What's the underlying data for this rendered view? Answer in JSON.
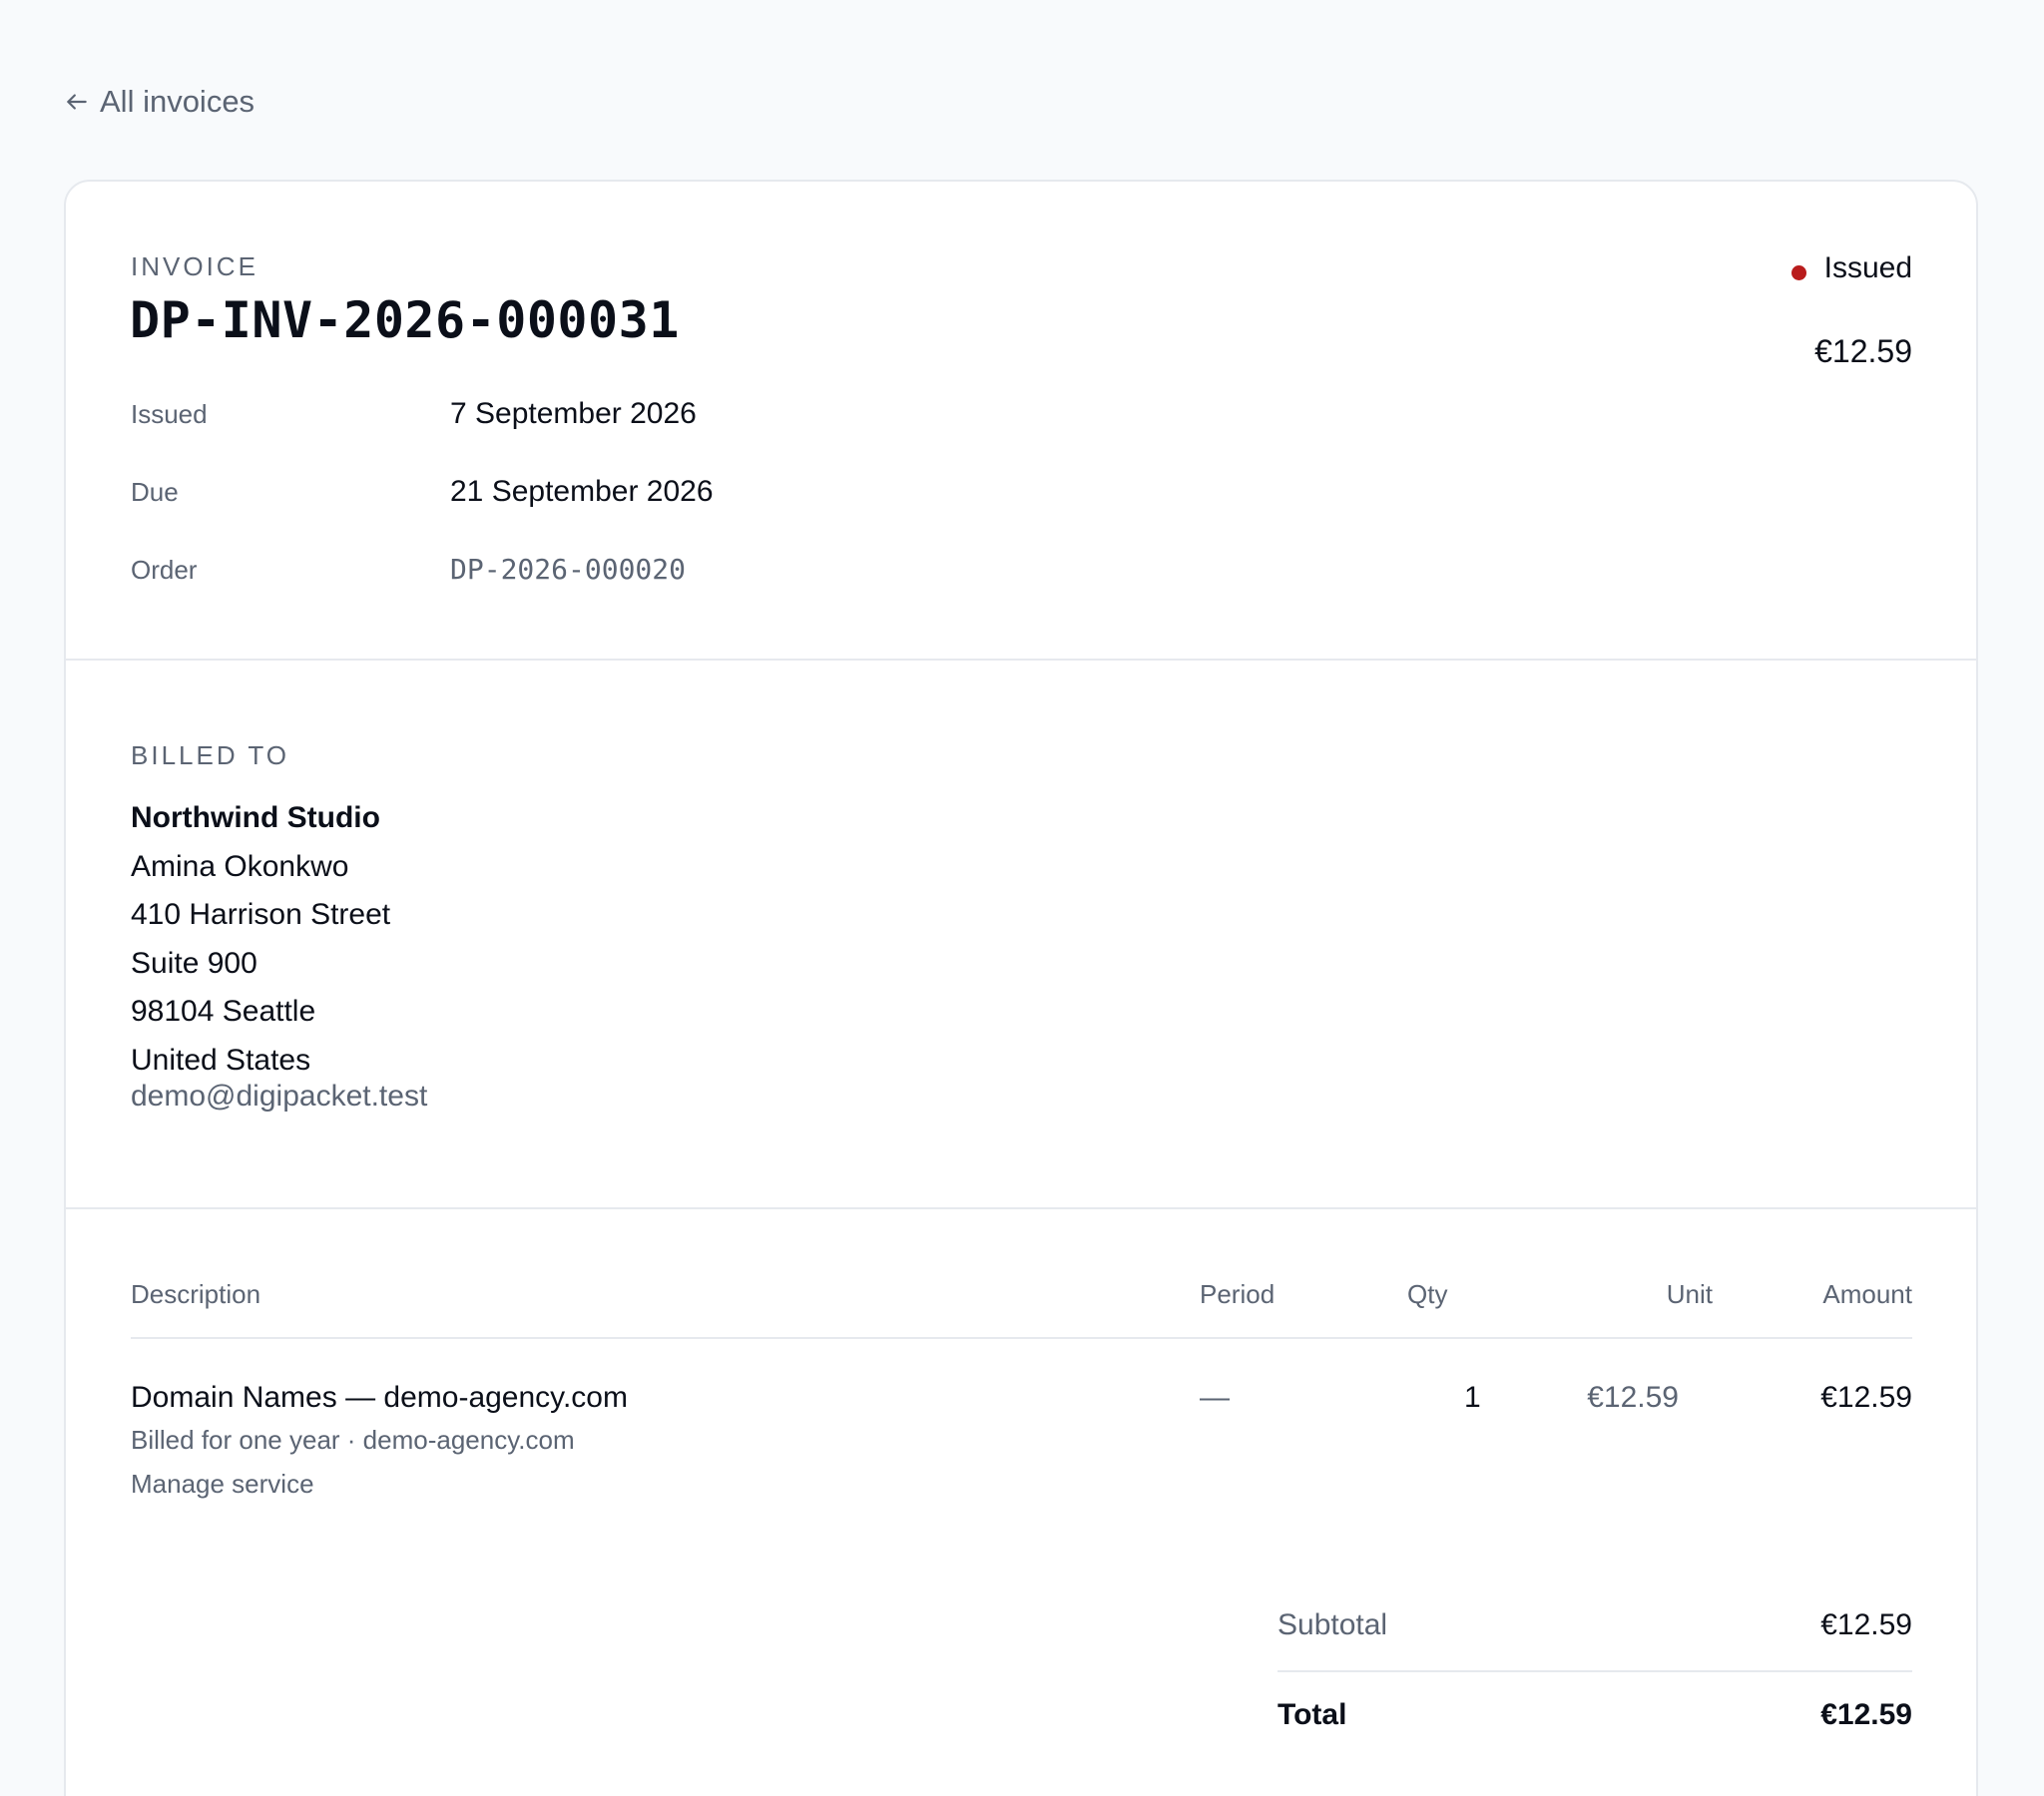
{
  "nav": {
    "back_label": "All invoices"
  },
  "invoice": {
    "eyebrow": "INVOICE",
    "number": "DP-INV-2026-000031",
    "status": "Issued",
    "amount": "€12.59",
    "meta": {
      "issued_label": "Issued",
      "issued_value": "7 September 2026",
      "due_label": "Due",
      "due_value": "21 September 2026",
      "order_label": "Order",
      "order_value": "DP-2026-000020"
    }
  },
  "billed_to": {
    "eyebrow": "BILLED TO",
    "company": "Northwind Studio",
    "name": "Amina Okonkwo",
    "address_line1": "410 Harrison Street",
    "address_line2": "Suite 900",
    "city_line": "98104 Seattle",
    "country": "United States",
    "email": "demo@digipacket.test"
  },
  "items": {
    "headers": {
      "description": "Description",
      "period": "Period",
      "qty": "Qty",
      "unit": "Unit",
      "amount": "Amount"
    },
    "rows": [
      {
        "description": "Domain Names — demo-agency.com",
        "billing_note": "Billed for one year · demo-agency.com",
        "manage_label": "Manage service",
        "period": "—",
        "qty": "1",
        "unit": "€12.59",
        "amount": "€12.59"
      }
    ]
  },
  "totals": {
    "subtotal_label": "Subtotal",
    "subtotal_value": "€12.59",
    "total_label": "Total",
    "total_value": "€12.59"
  },
  "colors": {
    "status_dot": "#b91c1c",
    "muted_text": "#5b6473",
    "border": "#e6e9ee"
  }
}
